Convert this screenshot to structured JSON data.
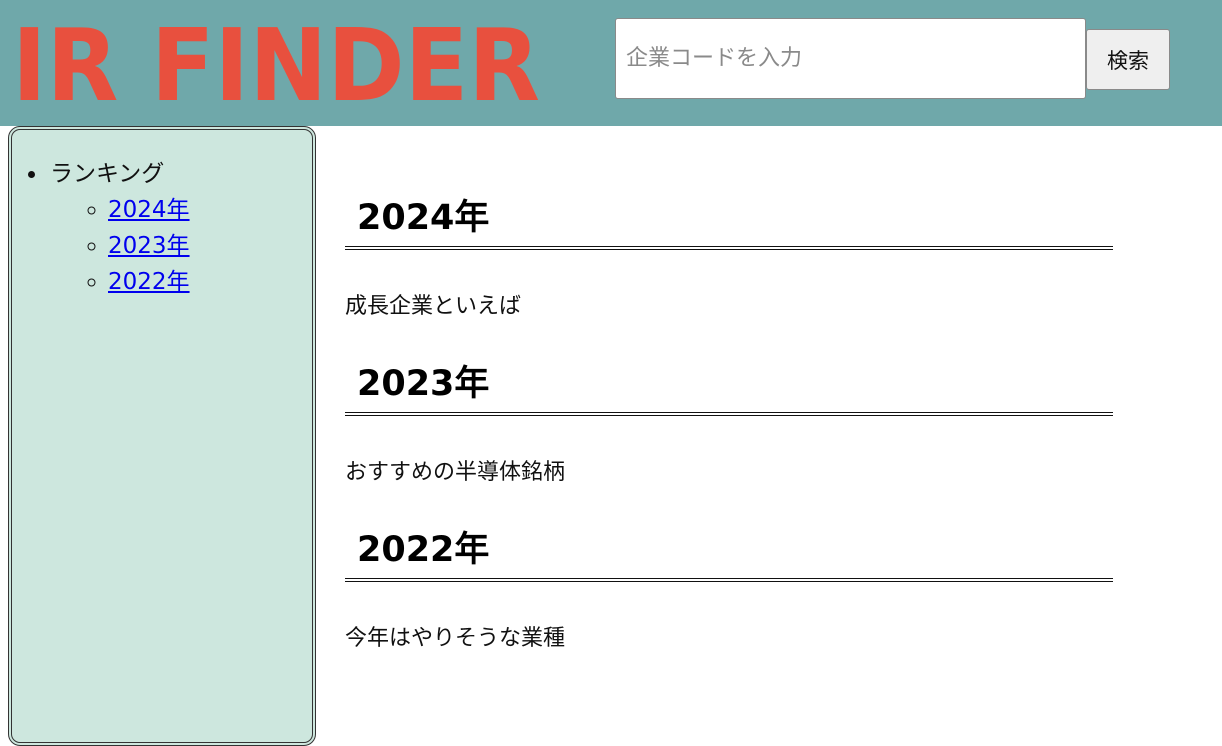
{
  "header": {
    "logo_text": "IR FINDER",
    "search": {
      "placeholder": "企業コードを入力",
      "value": "",
      "button_label": "検索"
    }
  },
  "colors": {
    "header_bg": "#6fa8aa",
    "logo": "#e8503e",
    "sidebar_bg": "#cde7de",
    "link": "#0000ee"
  },
  "sidebar": {
    "title": "ランキング",
    "items": [
      {
        "label": "2024年"
      },
      {
        "label": "2023年"
      },
      {
        "label": "2022年"
      }
    ]
  },
  "main": {
    "sections": [
      {
        "heading": "2024年",
        "text": "成長企業といえば"
      },
      {
        "heading": "2023年",
        "text": "おすすめの半導体銘柄"
      },
      {
        "heading": "2022年",
        "text": "今年はやりそうな業種"
      }
    ]
  }
}
